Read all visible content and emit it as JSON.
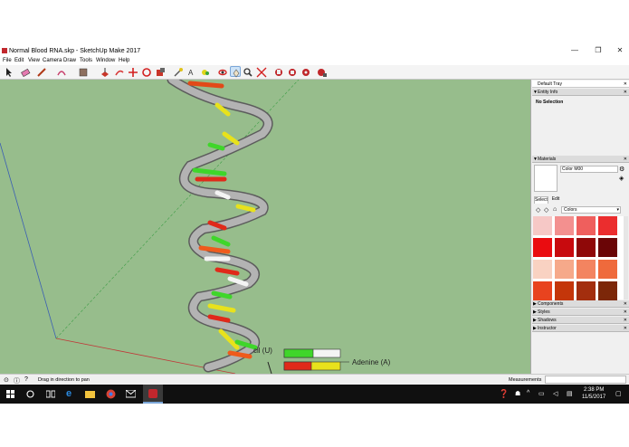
{
  "window": {
    "title": "Normal Blood RNA.skp - SketchUp Make 2017",
    "minimize": "—",
    "maximize": "❐",
    "close": "✕"
  },
  "menu": [
    "File",
    "Edit",
    "View",
    "Camera",
    "Draw",
    "Tools",
    "Window",
    "Help"
  ],
  "viewport": {
    "label_adenine": "Adenine (A)",
    "label_uracil": "cil (U)"
  },
  "tray": {
    "title": "Default Tray",
    "entity_info": {
      "header": "Entity Info",
      "selection": "No Selection"
    },
    "materials": {
      "header": "Materials",
      "material_name": "Color M00",
      "tab_select": "Select",
      "tab_edit": "Edit",
      "library": "Colors",
      "swatches": [
        "#f6c8c6",
        "#f3908f",
        "#ef5f5d",
        "#eb2d2e",
        "#ea0c10",
        "#c80a0e",
        "#8f0808",
        "#6a0506",
        "#f9d2c2",
        "#f6a98a",
        "#f38460",
        "#ef6a3c",
        "#e8431f",
        "#c4360a",
        "#a32e0e",
        "#7c2709"
      ]
    },
    "collapsed": [
      "Components",
      "Styles",
      "Shadows",
      "Instructor"
    ]
  },
  "status": {
    "hint": "Drag in direction to pan",
    "measurements_label": "Measurements"
  },
  "taskbar": {
    "time": "2:38 PM",
    "date": "11/5/2017"
  },
  "colors": {
    "viewport_bg": "#97bd8c",
    "helix": "#a8a8a8",
    "red_base": "#e02a1a",
    "orange_base": "#ef5a1c",
    "yellow_base": "#e8e21c",
    "green_base": "#3fd62a",
    "white_base": "#f4f4f4"
  }
}
